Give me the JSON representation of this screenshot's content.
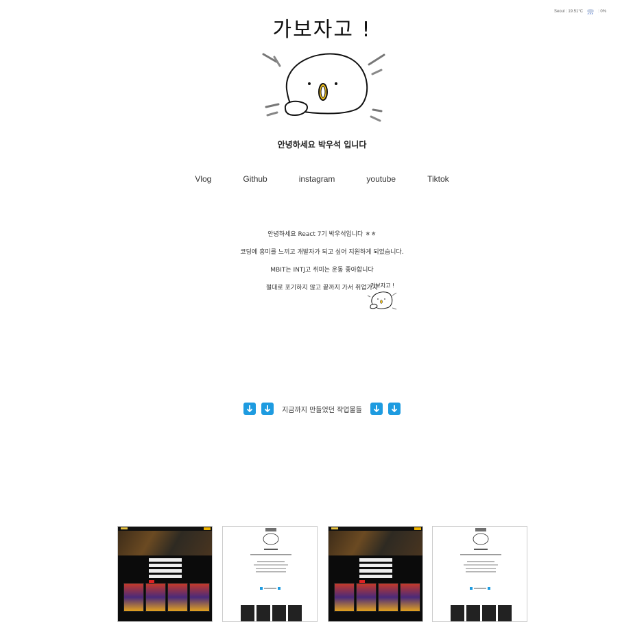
{
  "weather": {
    "text": "Seoul : 19.51°C",
    "humidity": ": 0%",
    "icon": "rain-cloud-icon"
  },
  "header": {
    "title": "가보자고 !"
  },
  "greeting": "안녕하세요 박우석 입니다",
  "nav": {
    "items": [
      {
        "label": "Vlog"
      },
      {
        "label": "Github"
      },
      {
        "label": "instagram"
      },
      {
        "label": "youtube"
      },
      {
        "label": "Tiktok"
      }
    ]
  },
  "intro": {
    "lines": [
      "안녕하세요 React 7기 박우석입니다 ㅎㅎ",
      "코딩에 흥미를 느끼고 개발자가 되고 싶어 지원하게 되었습니다.",
      "MBIT는 INTJ고 취미는 운동 좋아합니다",
      "절대로 포기하지 않고 끝까지 가서 취업가지"
    ],
    "sticker_text": "가보자고 !"
  },
  "works": {
    "label": "지금까지 만들었던 작업물들",
    "arrow_icon": "arrow-down-icon",
    "arrow_color": "#1e9be0"
  },
  "projects": [
    {
      "name": "movie-project",
      "theme": "dark"
    },
    {
      "name": "portfolio-project",
      "theme": "light"
    },
    {
      "name": "movie-project",
      "theme": "dark"
    },
    {
      "name": "portfolio-project",
      "theme": "light"
    }
  ]
}
